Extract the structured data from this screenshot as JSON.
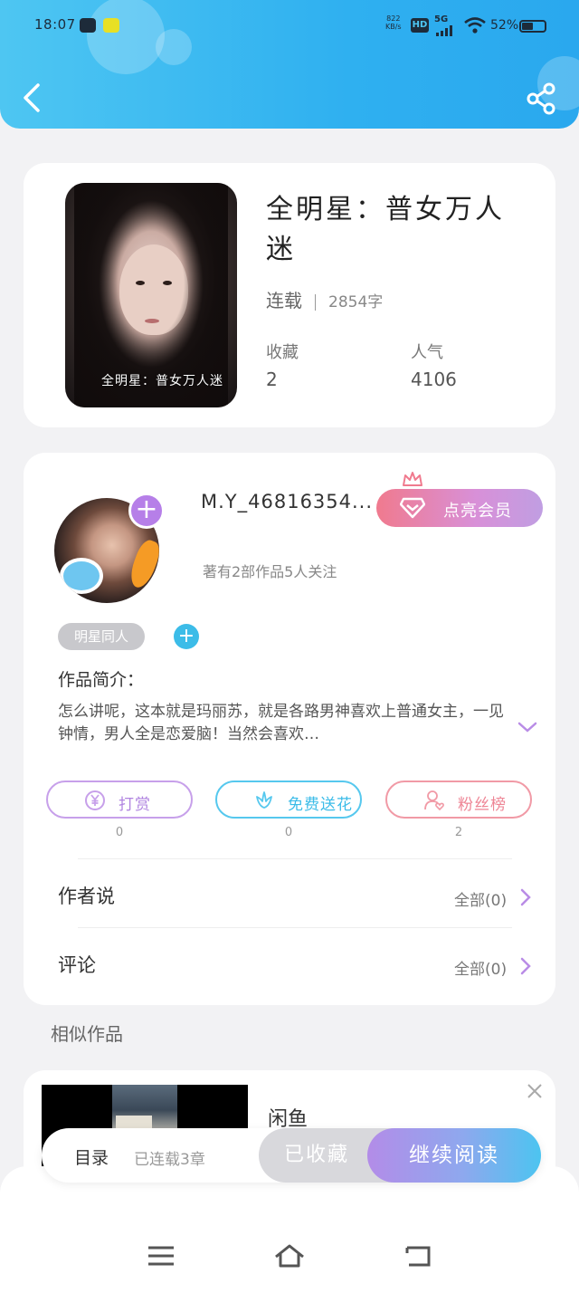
{
  "status_bar": {
    "time": "18:07",
    "net_speed_value": "822",
    "net_speed_unit": "KB/s",
    "hd": "HD",
    "network": "5G",
    "battery": "52%"
  },
  "header": {
    "back_icon": "chevron-left-icon",
    "share_icon": "share-icon"
  },
  "book": {
    "cover_caption": "全明星：普女万人迷",
    "title": "全明星：普女万人迷",
    "status": "连载",
    "word_count": "2854字",
    "favorites_label": "收藏",
    "favorites_value": "2",
    "popularity_label": "人气",
    "popularity_value": "4106"
  },
  "author": {
    "name": "M.Y_46816354...",
    "vip_button": "点亮会员",
    "meta": "著有2部作品5人关注",
    "tag": "明星同人",
    "intro_label": "作品简介：",
    "intro_text": "怎么讲呢，这本就是玛丽苏，就是各路男神喜欢上普通女主，一见钟情，男人全是恋爱脑！当然会喜欢…"
  },
  "actions": [
    {
      "label": "打赏",
      "count": "0",
      "color": "#c7a0ea",
      "icon": "yen-coin-icon"
    },
    {
      "label": "免费送花",
      "count": "0",
      "color": "#56c8ee",
      "icon": "flower-icon"
    },
    {
      "label": "粉丝榜",
      "count": "2",
      "color": "#f19aa6",
      "icon": "user-heart-icon"
    }
  ],
  "rows": {
    "author_says": {
      "label": "作者说",
      "right": "全部(0)"
    },
    "comments": {
      "label": "评论",
      "right": "全部(0)"
    }
  },
  "similar": {
    "section_title": "相似作品",
    "item_title": "闲鱼"
  },
  "bottom_bar": {
    "toc": "目录",
    "chapters": "已连载3章",
    "collected": "已收藏",
    "continue": "继续阅读"
  },
  "colors": {
    "header_blue": "#2fb0f0",
    "accent_purple": "#b67fe8",
    "vip_pink": "#f07a8e"
  }
}
